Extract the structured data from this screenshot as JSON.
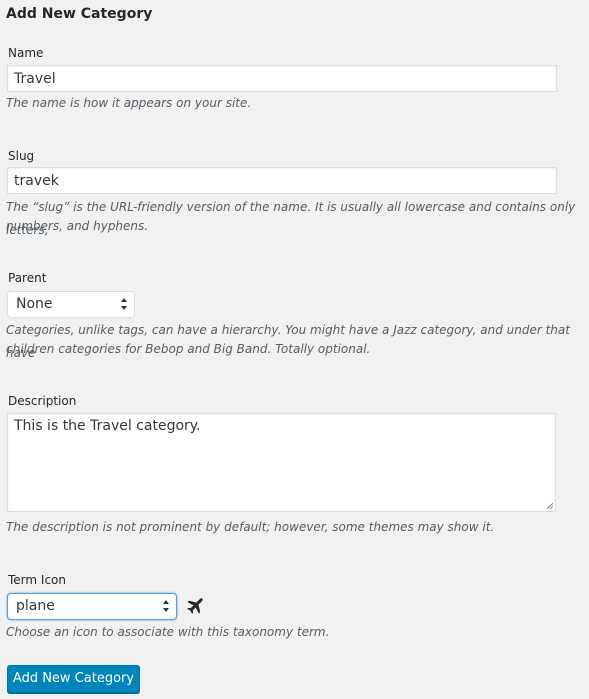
{
  "form": {
    "title": "Add New Category",
    "submit_label": "Add New Category"
  },
  "name": {
    "label": "Name",
    "value": "Travel",
    "help": "The name is how it appears on your site."
  },
  "slug": {
    "label": "Slug",
    "value": "travek",
    "help_line1": "The “slug” is the URL-friendly version of the name. It is usually all lowercase and contains only letters,",
    "help_line2": "numbers, and hyphens."
  },
  "parent": {
    "label": "Parent",
    "selected": "None",
    "help_line1": "Categories, unlike tags, can have a hierarchy. You might have a Jazz category, and under that have",
    "help_line2": "children categories for Bebop and Big Band. Totally optional."
  },
  "description": {
    "label": "Description",
    "value": "This is the Travel category.",
    "help": "The description is not prominent by default; however, some themes may show it."
  },
  "term_icon": {
    "label": "Term Icon",
    "selected": "plane",
    "icon": "plane-icon",
    "help": "Choose an icon to associate with this taxonomy term."
  },
  "colors": {
    "background": "#f1f1f1",
    "button": "#0085ba",
    "focus_border": "#5b9dd9"
  }
}
